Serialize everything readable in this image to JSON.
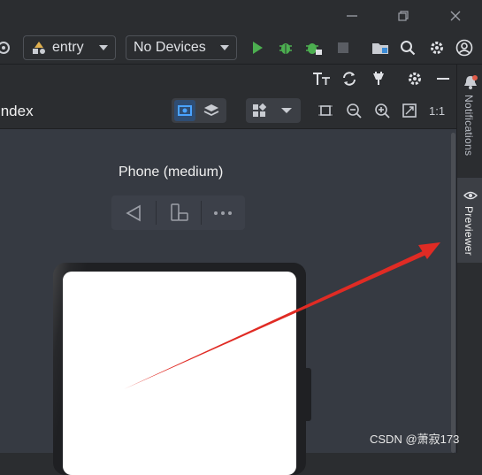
{
  "window": {
    "minimize_icon": "minimize-icon",
    "restore_icon": "restore-icon",
    "close_icon": "close-icon"
  },
  "toolbar": {
    "module_select": "entry",
    "device_select": "No Devices",
    "run_icon": "run-icon",
    "debug_icon": "debug-icon",
    "attach_debugger_icon": "attach-debugger-icon",
    "stop_icon": "stop-icon",
    "colors": {
      "run": "#4caf50",
      "debug": "#4caf50"
    }
  },
  "previewer": {
    "tab_title": "Index",
    "device_name": "Phone (medium)",
    "device_controls": [
      "back-icon",
      "rotate-icon",
      "more-icon"
    ]
  },
  "right_sidebar": {
    "notifications_label": "Notifications",
    "previewer_label": "Previewer"
  },
  "annotation": {
    "arrow_color": "#e02b24"
  },
  "watermark": {
    "text": "CSDN @萧寂173"
  }
}
